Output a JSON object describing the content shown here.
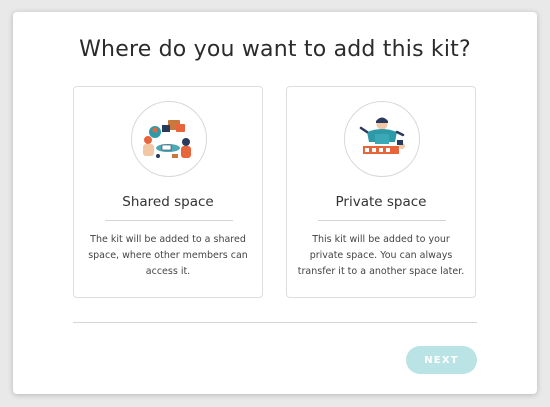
{
  "dialog": {
    "title": "Where do you want to add this kit?",
    "options": [
      {
        "title": "Shared space",
        "description": "The kit will be added to a shared space, where other members can access it.",
        "illustration": "team-collaboration-illustration"
      },
      {
        "title": "Private space",
        "description": "This kit will be added to your private space. You can always transfer it to a another space later.",
        "illustration": "person-working-alone-illustration"
      }
    ],
    "next_label": "NEXT"
  },
  "colors": {
    "accent_disabled": "#b9e3e4",
    "illustration_orange": "#e8643a",
    "illustration_teal": "#2e9aa8",
    "illustration_navy": "#2a3a5c"
  }
}
